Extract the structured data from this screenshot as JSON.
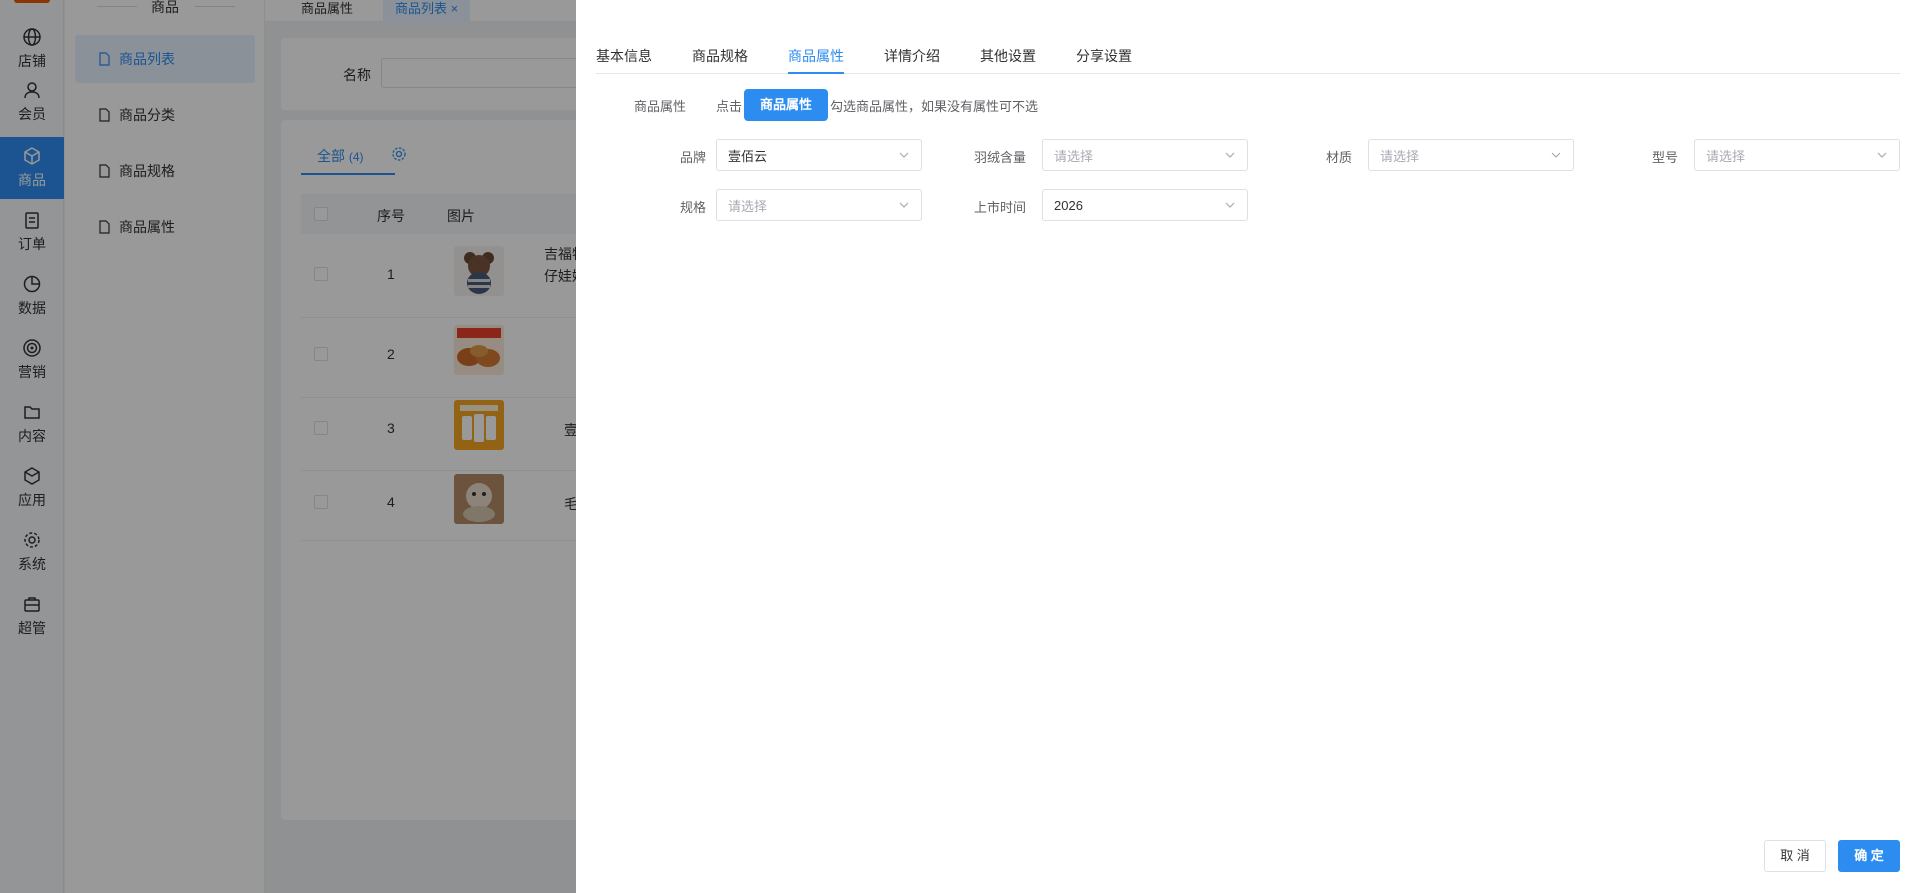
{
  "rail": {
    "items": [
      {
        "label": "店铺",
        "icon": "globe-icon"
      },
      {
        "label": "会员",
        "icon": "user-icon"
      },
      {
        "label": "商品",
        "icon": "cube-icon"
      },
      {
        "label": "订单",
        "icon": "clipboard-icon"
      },
      {
        "label": "数据",
        "icon": "pie-chart-icon"
      },
      {
        "label": "营销",
        "icon": "target-icon"
      },
      {
        "label": "内容",
        "icon": "folder-icon"
      },
      {
        "label": "应用",
        "icon": "box-icon"
      },
      {
        "label": "系统",
        "icon": "gear-icon"
      },
      {
        "label": "超管",
        "icon": "briefcase-icon"
      }
    ],
    "active_index": 2
  },
  "subnav": {
    "title": "商品",
    "items": [
      {
        "label": "商品列表"
      },
      {
        "label": "商品分类"
      },
      {
        "label": "商品规格"
      },
      {
        "label": "商品属性"
      }
    ]
  },
  "page_tabs": [
    {
      "label": "商品属性"
    },
    {
      "label": "商品列表",
      "close": "×"
    }
  ],
  "filter": {
    "name_label": "名称"
  },
  "list": {
    "tab_all": "全部",
    "tab_count": "(4)",
    "headers": {
      "index": "序号",
      "image": "图片"
    },
    "rows": [
      {
        "index": "1",
        "name_line1": "吉福特",
        "name_line2": "仔娃娃"
      },
      {
        "index": "2",
        "name_line1": "",
        "name_line2": ""
      },
      {
        "index": "3",
        "name_line1": "壹",
        "name_line2": ""
      },
      {
        "index": "4",
        "name_line1": "毛",
        "name_line2": ""
      }
    ]
  },
  "drawer": {
    "tabs": [
      {
        "label": "基本信息"
      },
      {
        "label": "商品规格"
      },
      {
        "label": "商品属性"
      },
      {
        "label": "详情介绍"
      },
      {
        "label": "其他设置"
      },
      {
        "label": "分享设置"
      }
    ],
    "active_tab_index": 2,
    "attr_label": "商品属性",
    "attr_hint_prefix": "点击",
    "attr_button": "商品属性",
    "attr_hint_suffix": "勾选商品属性，如果没有属性可不选",
    "fields": {
      "brand": {
        "label": "品牌",
        "value": "壹佰云"
      },
      "down": {
        "label": "羽绒含量",
        "placeholder": "请选择"
      },
      "material": {
        "label": "材质",
        "placeholder": "请选择"
      },
      "model": {
        "label": "型号",
        "placeholder": "请选择"
      },
      "spec": {
        "label": "规格",
        "placeholder": "请选择"
      },
      "launch": {
        "label": "上市时间",
        "value": "2026"
      }
    },
    "cancel": "取 消",
    "confirm": "确 定"
  },
  "colors": {
    "accent": "#2d8cf0",
    "mask": "rgba(0,0,0,0.4)"
  }
}
